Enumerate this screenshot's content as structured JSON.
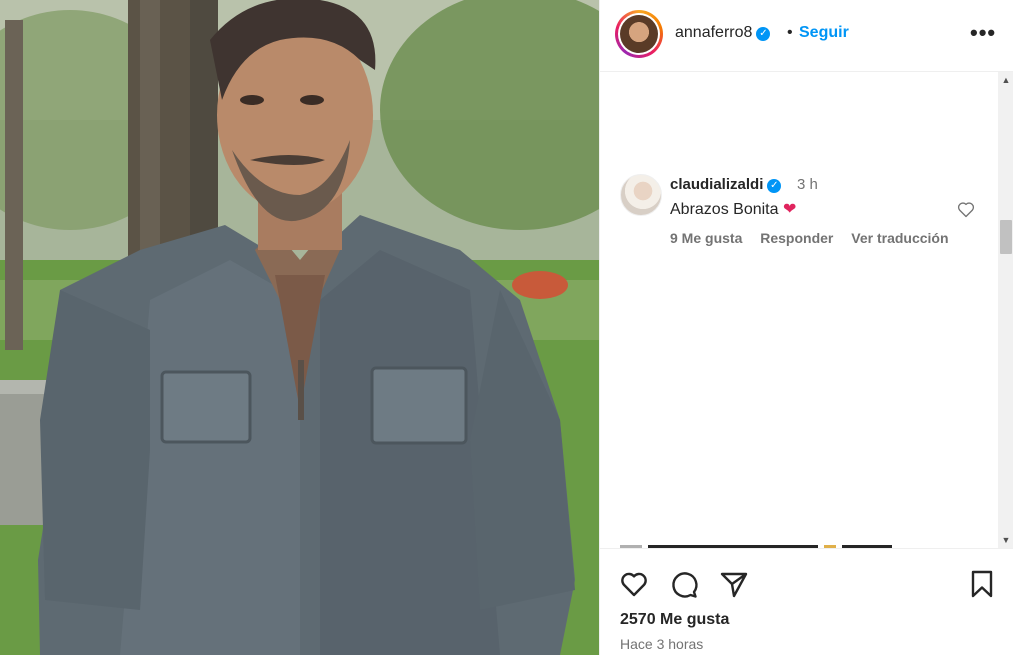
{
  "post": {
    "author": "annaferro8",
    "follow_label": "Seguir",
    "separator": "•",
    "more_label": "•••",
    "verified_mark": "✓",
    "likes": "2570 Me gusta",
    "time_ago": "Hace 3 horas"
  },
  "comment": {
    "user": "claudializaldi",
    "time": "3 h",
    "text": "Abrazos Bonita",
    "emoji": "❤",
    "likes": "9 Me gusta",
    "reply_label": "Responder",
    "translate_label": "Ver traducción"
  },
  "icons": {
    "post_like": "heart-outline-icon",
    "comment": "comment-bubble-icon",
    "share": "paper-plane-icon",
    "save": "bookmark-icon",
    "comment_like": "heart-outline-icon",
    "verified": "verified-badge-icon"
  },
  "colors": {
    "accent": "#0095f6",
    "text": "#262626",
    "secondary": "#737373",
    "heart": "#e0245e"
  }
}
